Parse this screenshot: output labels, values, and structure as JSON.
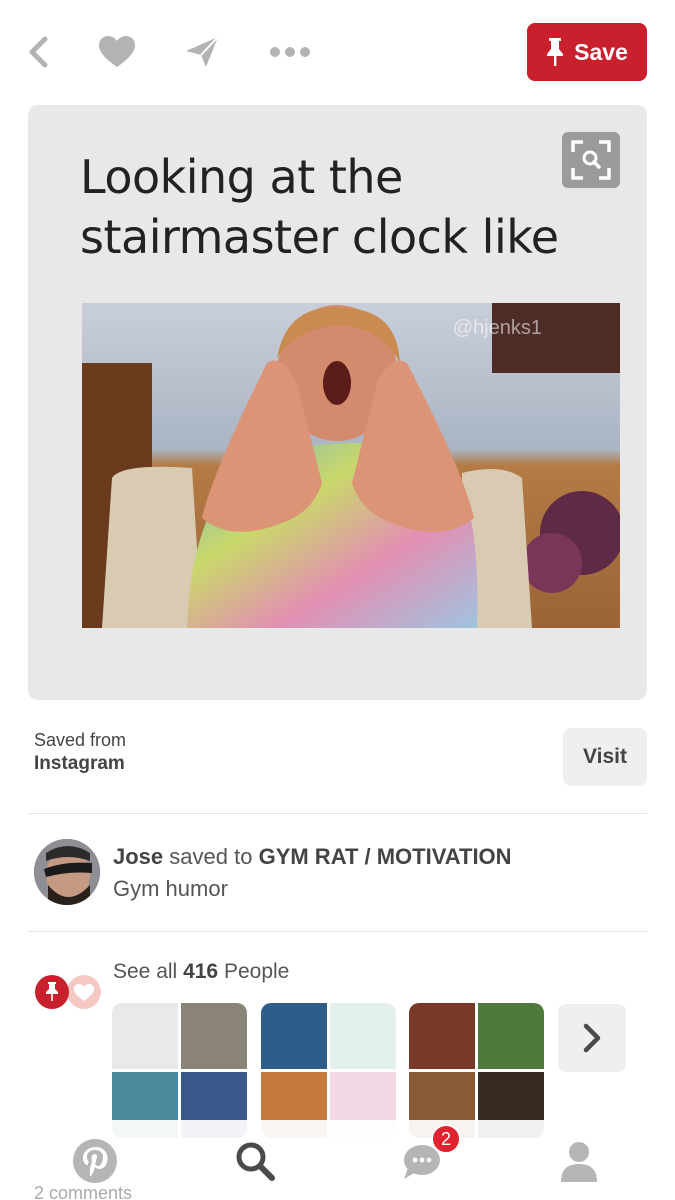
{
  "topbar": {
    "save_label": "Save",
    "icons": [
      "back-arrow-icon",
      "heart-icon",
      "send-icon",
      "more-icon"
    ]
  },
  "pin": {
    "caption_line1": "Looking at the",
    "caption_line2": "stairmaster clock like",
    "watermark": "@hjenks1"
  },
  "source": {
    "label": "Saved from",
    "name": "Instagram",
    "visit_label": "Visit"
  },
  "saver": {
    "name": "Jose",
    "action": "saved to",
    "board": "GYM RAT / MOTIVATION",
    "description": "Gym humor"
  },
  "people": {
    "prefix": "See all",
    "count": "416",
    "suffix": "People"
  },
  "tabbar": {
    "notification_count": "2",
    "tabs": [
      "pinterest-home-icon",
      "search-icon",
      "messages-icon",
      "profile-icon"
    ]
  },
  "comments_peek": "2 comments",
  "colors": {
    "brand": "#c8202d",
    "badge": "#e1232f"
  }
}
